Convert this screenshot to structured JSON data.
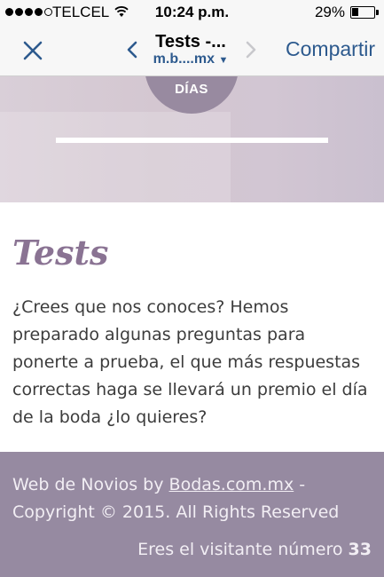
{
  "status": {
    "carrier": "TELCEL",
    "time": "10:24 p.m.",
    "battery_percent": "29%",
    "battery_level": 0.29
  },
  "browser": {
    "tab_title": "Tests -...",
    "url": "m.b....mx",
    "share_label": "Compartir",
    "accent_color": "#2d5a8e"
  },
  "hero": {
    "days_label": "DÍAS"
  },
  "content": {
    "heading": "Tests",
    "paragraph": "¿Crees que nos conoces? Hemos preparado algunas preguntas para ponerte a prueba, el que más respuestas correctas haga se llevará un premio el día de la boda ¿lo quieres?",
    "heading_color": "#8a7393"
  },
  "footer": {
    "prefix": "Web de Novios by ",
    "link_text": "Bodas.com.mx",
    "suffix": " - Copyright © 2015. All Rights Reserved",
    "visitor_label": "Eres el visitante número",
    "visitor_count": "33",
    "background_color": "#968aa1"
  }
}
